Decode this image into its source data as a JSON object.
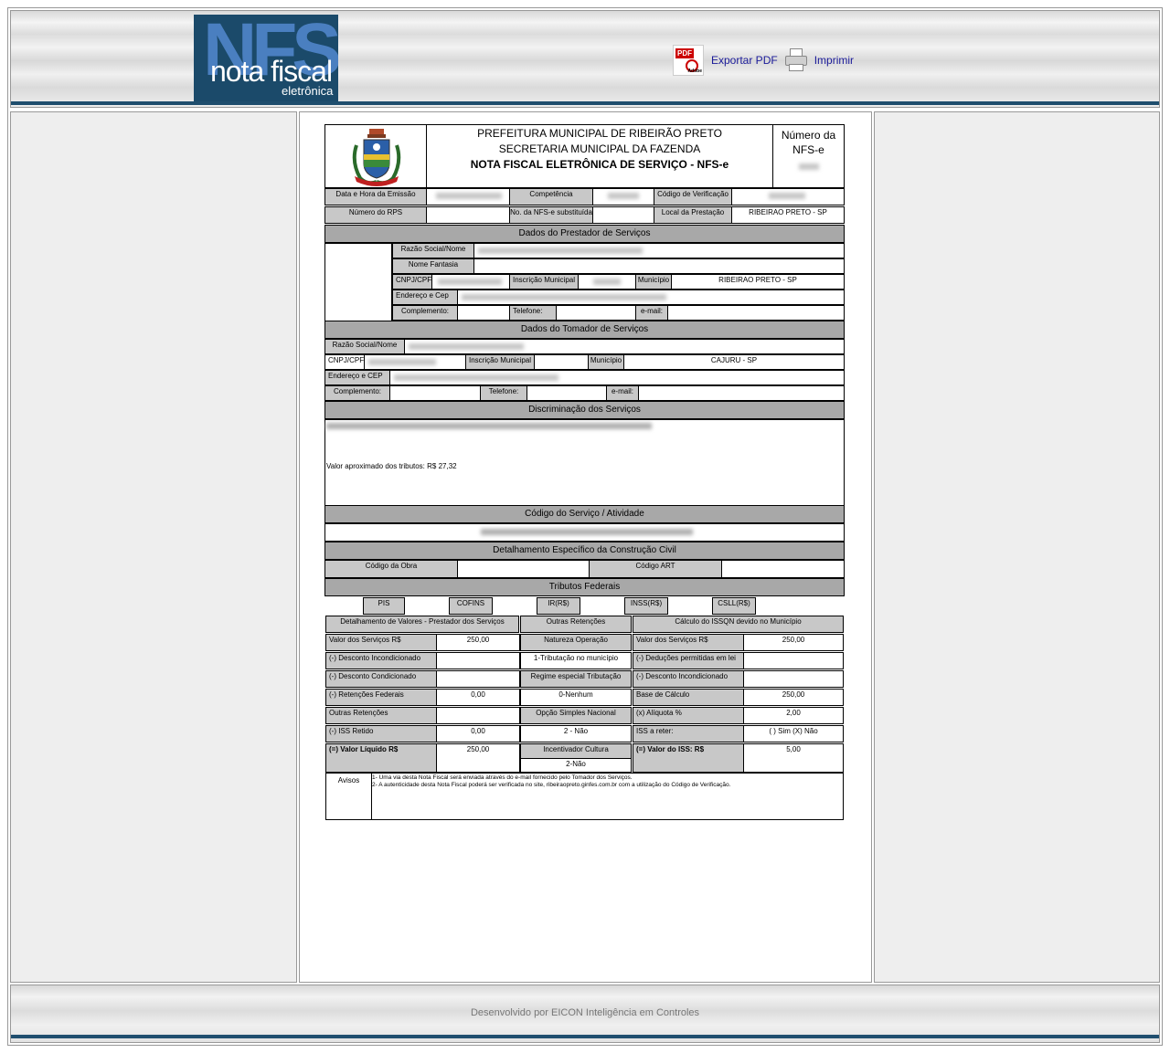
{
  "header": {
    "logo": {
      "big": "NFS",
      "line1": "nota fiscal",
      "line2": "eletrônica"
    },
    "export_pdf_label": "Exportar PDF",
    "pdf_icon_text": "PDF",
    "pdf_icon_brand": "Adobe",
    "print_label": "Imprimir"
  },
  "document": {
    "title_line1": "PREFEITURA MUNICIPAL DE RIBEIRÃO PRETO",
    "title_line2": "SECRETARIA MUNICIPAL DA FAZENDA",
    "title_line3": "NOTA FISCAL ELETRÔNICA DE SERVIÇO - NFS-e",
    "numero_label": "Número da NFS-e",
    "labels": {
      "data_emissao": "Data e Hora da Emissão",
      "competencia": "Competência",
      "codigo_verificacao": "Código de Verificação",
      "numero_rps": "Número do RPS",
      "nfse_substituida": "No. da NFS-e substituída",
      "local_prestacao": "Local da Prestação"
    },
    "local_prestacao_value": "RIBEIRAO PRETO - SP",
    "prestador": {
      "section_title": "Dados do Prestador de Serviços",
      "razao_social": "Razão Social/Nome",
      "nome_fantasia": "Nome Fantasia",
      "cnpj": "CNPJ/CPF",
      "inscricao_municipal": "Inscrição Municipal",
      "municipio": "Município",
      "municipio_value": "RIBEIRAO PRETO - SP",
      "endereco": "Endereço e Cep",
      "complemento": "Complemento:",
      "telefone": "Telefone:",
      "email": "e-mail:"
    },
    "tomador": {
      "section_title": "Dados do Tomador de Serviços",
      "razao_social": "Razão Social/Nome",
      "cnpj": "CNPJ/CPF",
      "inscricao_municipal": "Inscrição Municipal",
      "municipio": "Município",
      "municipio_value": "CAJURU - SP",
      "endereco": "Endereço e CEP",
      "complemento": "Complemento:",
      "telefone": "Telefone:",
      "email": "e-mail:"
    },
    "discriminacao": {
      "section_title": "Discriminação dos Serviços",
      "tributos_text": "Valor aproximado dos tributos: R$ 27,32"
    },
    "codigo_servico_title": "Código do Serviço / Atividade",
    "construcao": {
      "section_title": "Detalhamento Específico da Construção Civil",
      "codigo_obra": "Código da Obra",
      "codigo_art": "Código ART"
    },
    "tributos_federais": {
      "section_title": "Tributos Federais",
      "labels": [
        "PIS",
        "COFINS",
        "IR(R$)",
        "INSS(R$)",
        "CSLL(R$)"
      ]
    },
    "valores": {
      "col1_title": "Detalhamento de Valores - Prestador dos Serviços",
      "col2_title": "Outras Retenções",
      "col3_title": "Cálculo do ISSQN devido no Município",
      "rows1": [
        {
          "label": "Valor dos Serviços    R$",
          "value": "250,00"
        },
        {
          "label": "(-) Desconto Incondicionado",
          "value": ""
        },
        {
          "label": "(-) Desconto Condicionado",
          "value": ""
        },
        {
          "label": "(-) Retenções Federais",
          "value": "0,00"
        },
        {
          "label": "Outras Retenções",
          "value": ""
        },
        {
          "label": "(-) ISS Retido",
          "value": "0,00"
        },
        {
          "label": "(=)  Valor Líquido        R$",
          "value": "250,00"
        }
      ],
      "rows2": [
        {
          "label": "Natureza Operação",
          "value": "1-Tributação no município"
        },
        {
          "label": "Regime especial Tributação",
          "value": "0-Nenhum"
        },
        {
          "label": "Opção Simples Nacional",
          "value": "2 - Não"
        },
        {
          "label": "Incentivador Cultura",
          "value": "2-Não"
        }
      ],
      "rows3": [
        {
          "label": "Valor dos Serviços    R$",
          "value": "250,00"
        },
        {
          "label": "(-)  Deduções permitidas em lei",
          "value": ""
        },
        {
          "label": "(-)  Desconto Incondicionado",
          "value": ""
        },
        {
          "label": "Base de Cálculo",
          "value": "250,00"
        },
        {
          "label": "(x) Alíquota   %",
          "value": "2,00"
        },
        {
          "label": "ISS a reter:",
          "value": "( ) Sim (X) Não"
        },
        {
          "label": "(=) Valor do ISS:      R$",
          "value": "5,00"
        }
      ]
    },
    "avisos": {
      "label": "Avisos",
      "line1": "1- Uma via desta Nota Fiscal será enviada através do e-mail fornecido pelo Tomador dos Serviços.",
      "line2": "2- A autenticidade desta Nota Fiscal poderá ser verificada no site, ribeiraopreto.ginfes.com.br com a utilização do Código de Verificação."
    }
  },
  "footer": {
    "text": "Desenvolvido por EICON Inteligência em Controles"
  },
  "colors": {
    "navy_bar": "#1f4e6e",
    "label_gray": "#c8c8c8",
    "section_gray": "#a8a8a8",
    "link": "#1a1a99"
  }
}
